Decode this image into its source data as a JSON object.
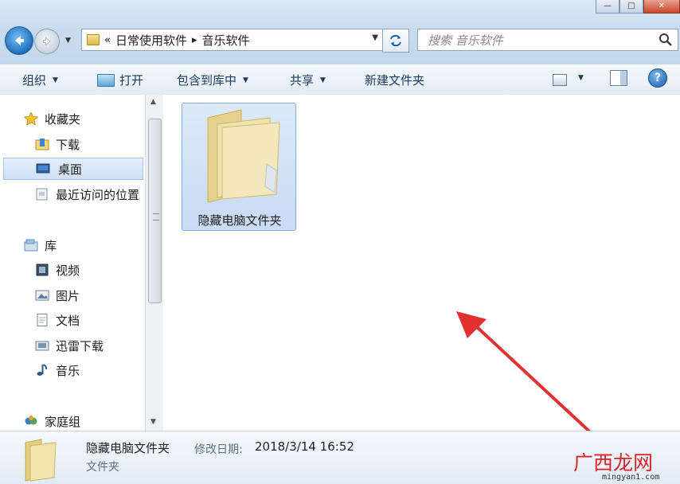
{
  "window": {
    "minimize_glyph": "—",
    "maximize_glyph": "□",
    "close_glyph": "✕"
  },
  "address": {
    "overflow": "«",
    "crumbs": [
      "日常使用软件",
      "音乐软件"
    ],
    "separator": "▸"
  },
  "search": {
    "placeholder": "搜索 音乐软件",
    "icon": "search-icon"
  },
  "toolbar": {
    "organize": "组织",
    "open": "打开",
    "include_library": "包含到库中",
    "share": "共享",
    "new_folder": "新建文件夹",
    "help": "?"
  },
  "sidebar": {
    "favorites": {
      "label": "收藏夹",
      "items": [
        "下载",
        "桌面",
        "最近访问的位置"
      ]
    },
    "libraries": {
      "label": "库",
      "items": [
        "视频",
        "图片",
        "文档",
        "迅雷下载",
        "音乐"
      ]
    },
    "homegroup": {
      "label": "家庭组"
    }
  },
  "content": {
    "items": [
      {
        "name": "隐藏电脑文件夹",
        "type": "folder",
        "selected": true
      }
    ]
  },
  "details": {
    "name": "隐藏电脑文件夹",
    "date_label": "修改日期:",
    "date": "2018/3/14 16:52",
    "type": "文件夹"
  },
  "watermark": {
    "text": "广西龙网",
    "url": "mingyan1.com"
  },
  "colors": {
    "annotation_arrow": "#e0322f",
    "selection": "#cfe0f6"
  }
}
